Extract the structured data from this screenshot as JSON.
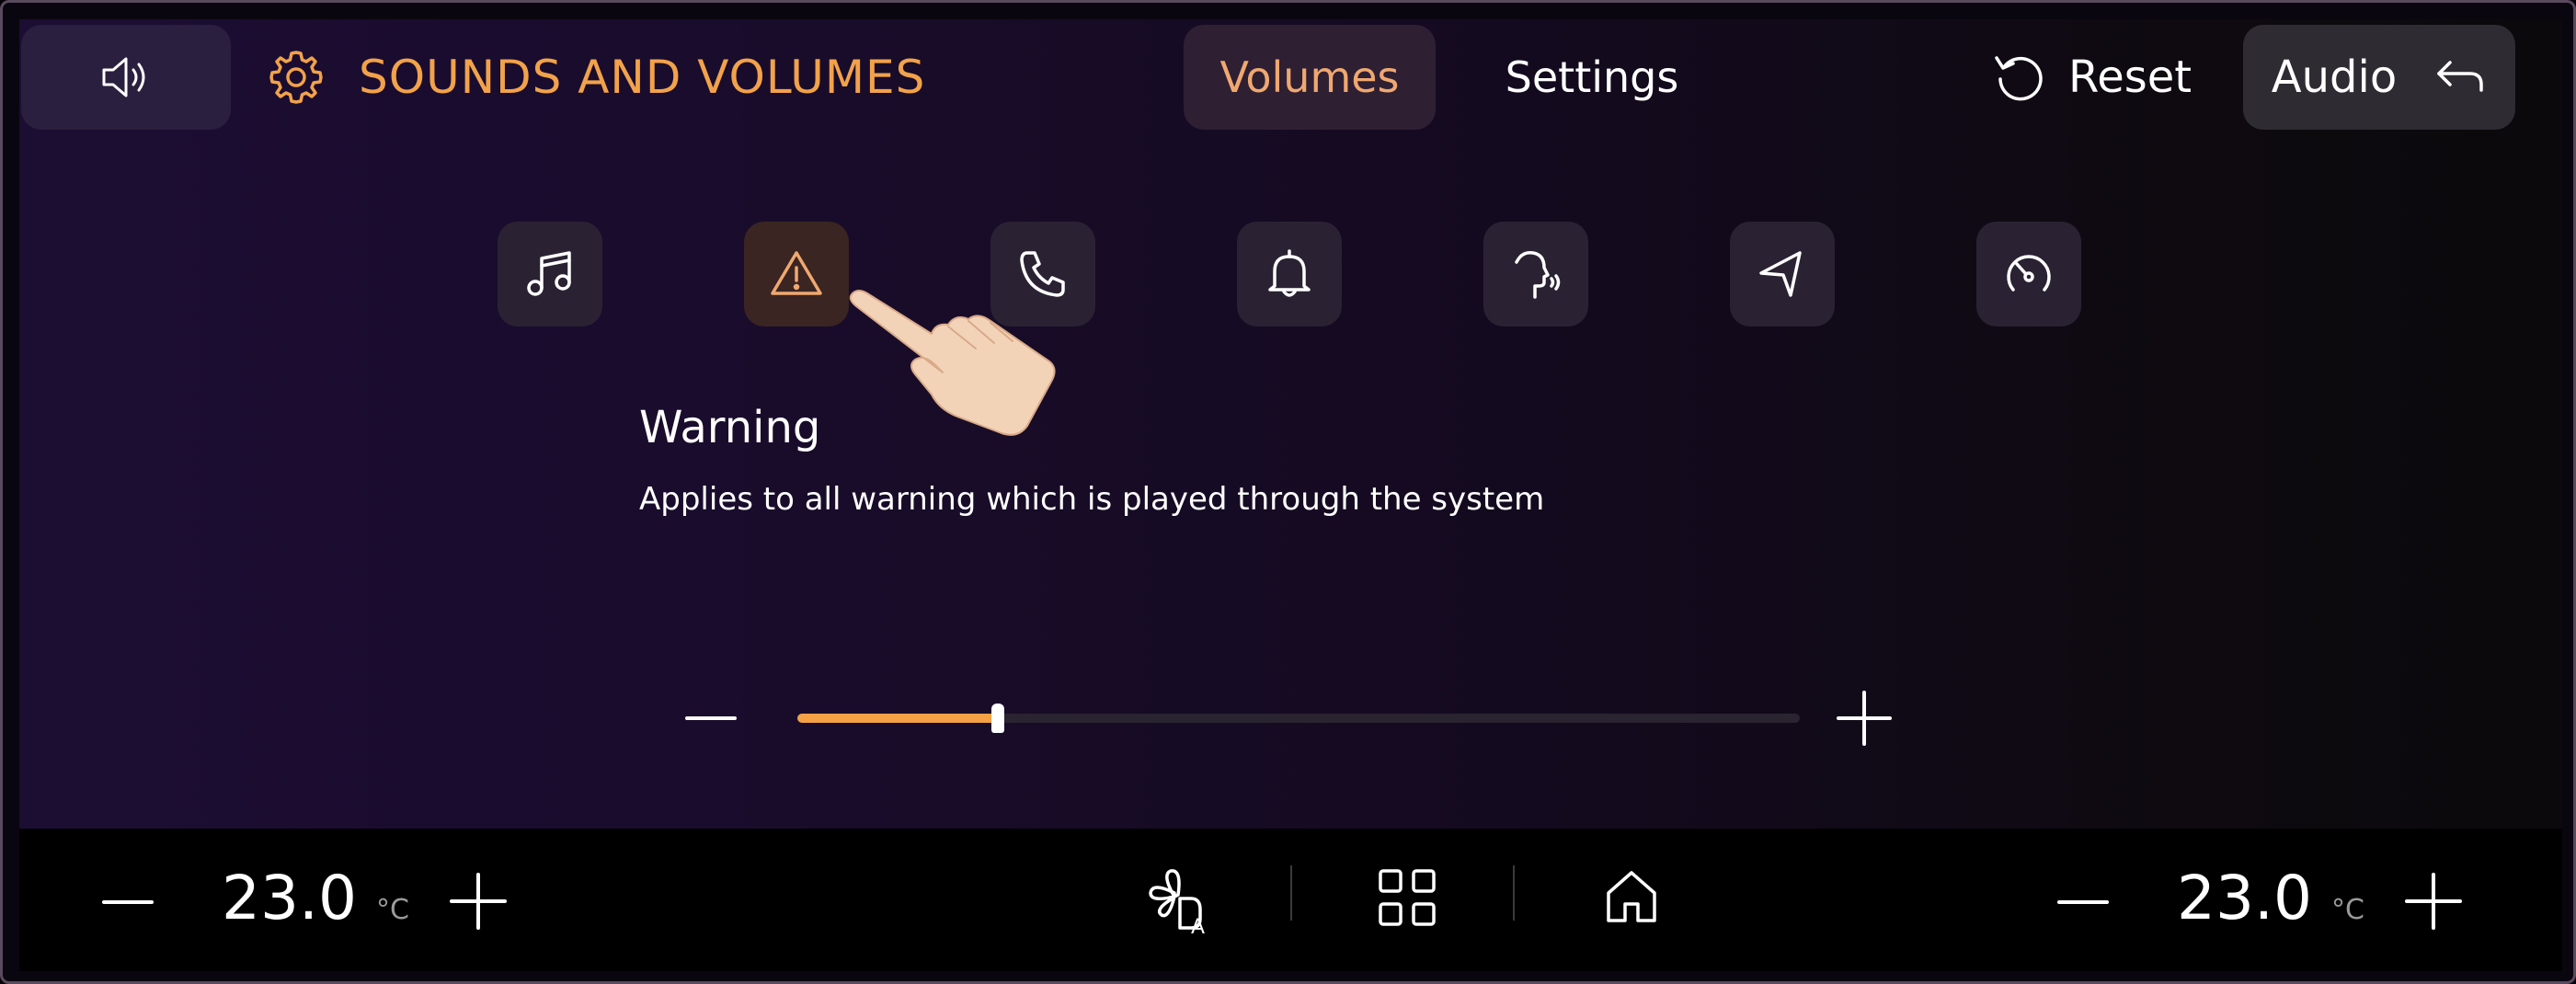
{
  "header": {
    "title": "SOUNDS AND VOLUMES",
    "tabs": [
      {
        "label": "Volumes",
        "active": true
      },
      {
        "label": "Settings",
        "active": false
      }
    ],
    "reset_label": "Reset",
    "audio_label": "Audio"
  },
  "categories": [
    {
      "icon": "music-note-icon",
      "active": false
    },
    {
      "icon": "warning-icon",
      "active": true
    },
    {
      "icon": "phone-icon",
      "active": false
    },
    {
      "icon": "bell-icon",
      "active": false
    },
    {
      "icon": "voice-assistant-icon",
      "active": false
    },
    {
      "icon": "navigation-icon",
      "active": false
    },
    {
      "icon": "speedometer-icon",
      "active": false
    }
  ],
  "section": {
    "title": "Warning",
    "description": "Applies to all warning which is played through the system"
  },
  "volume": {
    "level": 0.2
  },
  "climate": {
    "left_temp": "23.0",
    "right_temp": "23.0",
    "unit": "°C"
  },
  "colors": {
    "accent": "#f4a245",
    "title": "#f2a24a",
    "active_tab_text": "#f0a870"
  }
}
